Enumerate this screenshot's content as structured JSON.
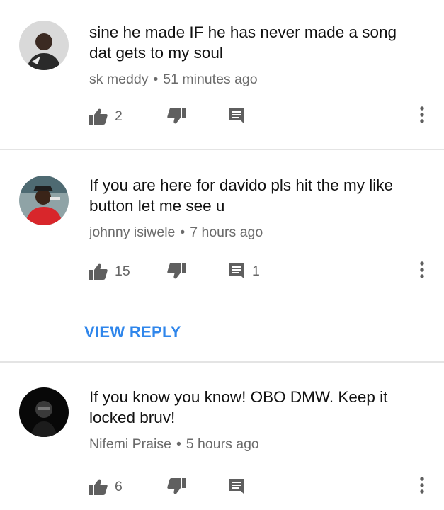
{
  "comments": [
    {
      "text": "sine he made IF he has never made a song\ndat gets to my soul",
      "author": "sk meddy",
      "separator": "•",
      "time": "51 minutes ago",
      "likes": "2",
      "replies": ""
    },
    {
      "text": "If you are here for davido pls hit the my like\nbutton let me see u",
      "author": "johnny isiwele",
      "separator": "•",
      "time": "7 hours ago",
      "likes": "15",
      "replies": "1",
      "view_reply_label": "VIEW REPLY"
    },
    {
      "text": "If you know you know! OBO DMW. Keep it\nlocked bruv!",
      "author": "Nifemi Praise",
      "separator": "•",
      "time": "5 hours ago",
      "likes": "6",
      "replies": ""
    }
  ],
  "icons": {
    "like": "thumbs-up-icon",
    "dislike": "thumbs-down-icon",
    "reply": "comment-icon",
    "more": "more-vert-icon"
  },
  "colors": {
    "text": "#111111",
    "meta": "#6b6b6b",
    "icon": "#5f5f5f",
    "link": "#2f86eb",
    "divider": "#e4e4e4"
  }
}
